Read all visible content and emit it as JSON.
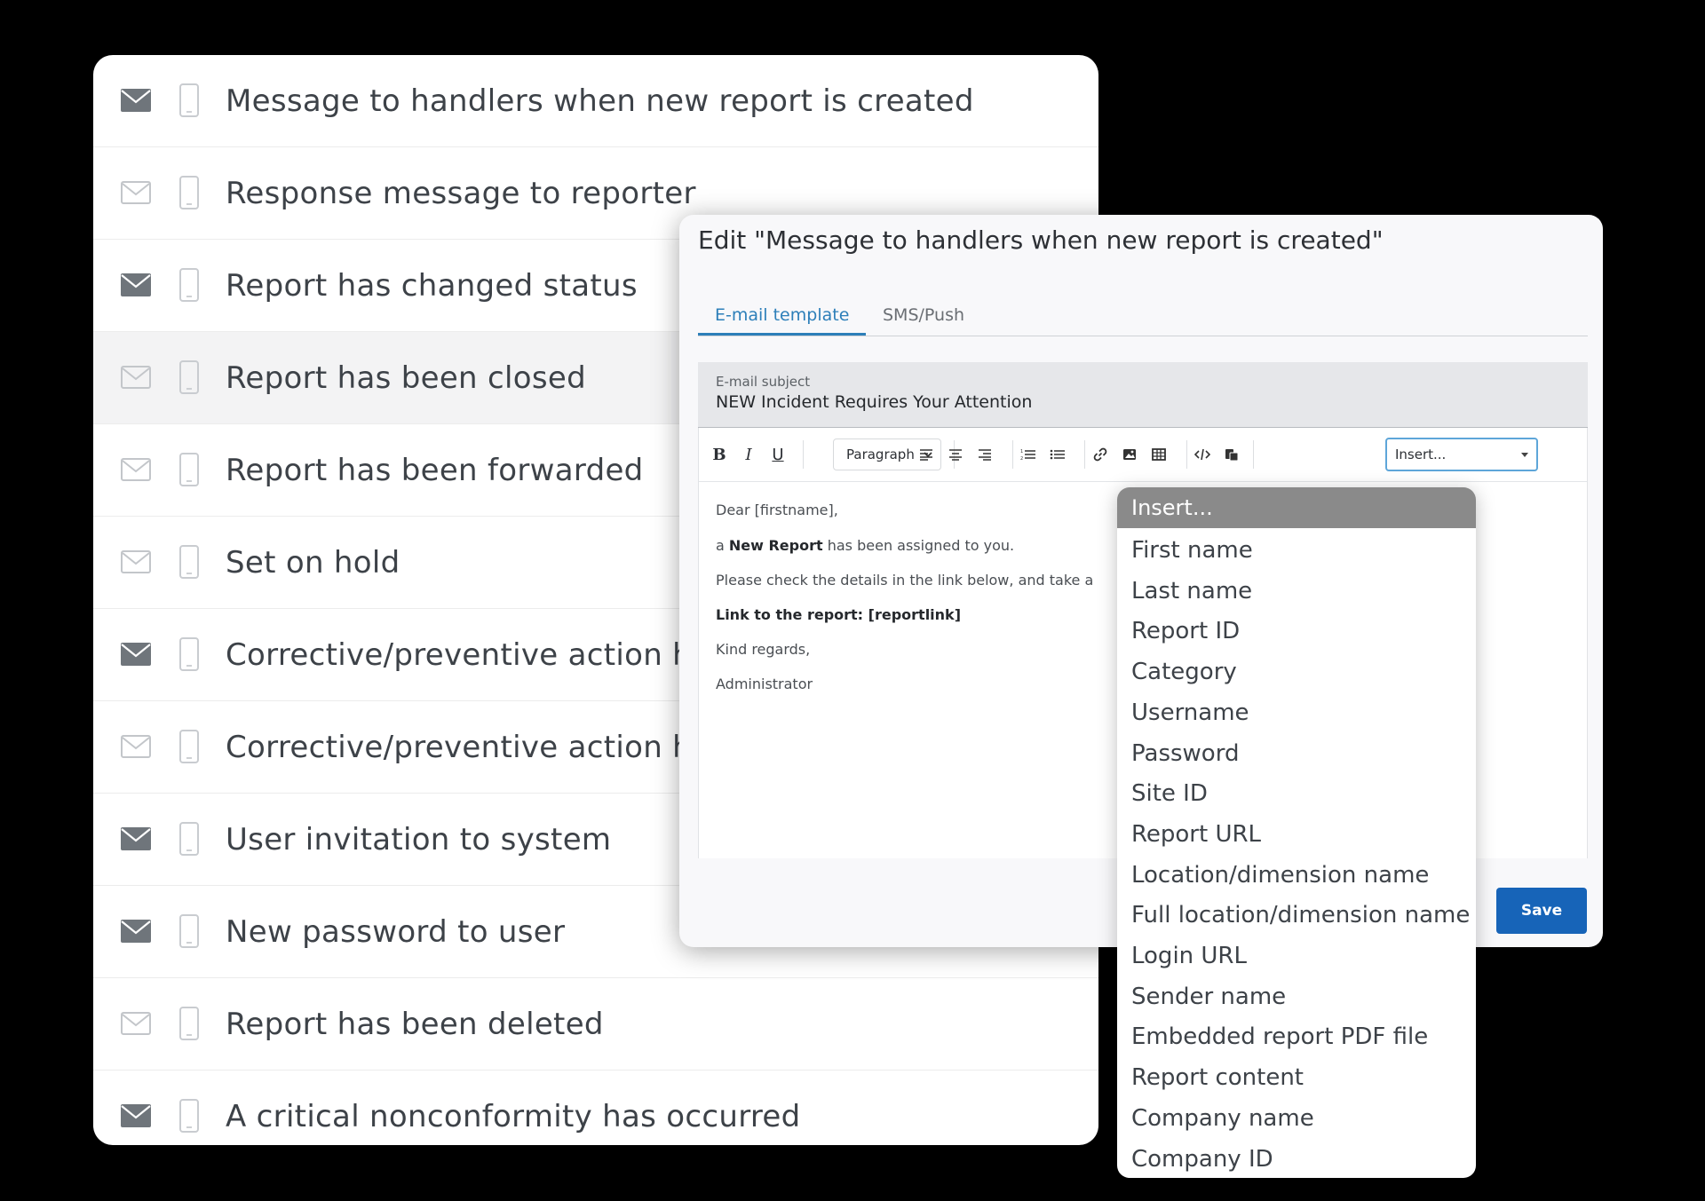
{
  "notification_list": {
    "rows": [
      {
        "label": "Message to handlers when new report is created",
        "email_active": true
      },
      {
        "label": "Response message to reporter",
        "email_active": false
      },
      {
        "label": "Report has changed status",
        "email_active": true
      },
      {
        "label": "Report has been closed",
        "email_active": false
      },
      {
        "label": "Report has been forwarded",
        "email_active": false
      },
      {
        "label": "Set on hold",
        "email_active": false
      },
      {
        "label": "Corrective/preventive action ha",
        "email_active": true
      },
      {
        "label": "Corrective/preventive action ha",
        "email_active": false
      },
      {
        "label": "User invitation to system",
        "email_active": true
      },
      {
        "label": "New password to user",
        "email_active": true
      },
      {
        "label": "Report has been deleted",
        "email_active": false
      },
      {
        "label": "A critical nonconformity has occurred",
        "email_active": true
      }
    ]
  },
  "dialog": {
    "title": "Edit \"Message to handlers when new report is created\"",
    "tabs": {
      "email": "E-mail template",
      "sms": "SMS/Push"
    },
    "subject": {
      "label": "E-mail subject",
      "value": "NEW Incident Requires Your Attention"
    },
    "toolbar": {
      "bold": "B",
      "italic": "I",
      "underline": "U",
      "paragraph": "Paragraph",
      "insert": "Insert..."
    },
    "body": {
      "greeting": "Dear [firstname],",
      "line1_prefix": "a ",
      "line1_bold": "New Report",
      "line1_suffix": " has been assigned to you.",
      "line2": "Please check the details in the link below, and take a",
      "line3": "Link to the report: [reportlink]",
      "line4": "Kind regards,",
      "line5": "Administrator"
    },
    "save_label": "Save"
  },
  "insert_dropdown": {
    "header": "Insert...",
    "items": [
      "First name",
      "Last name",
      "Report ID",
      "Category",
      "Username",
      "Password",
      "Site ID",
      "Report URL",
      "Location/dimension name",
      "Full location/dimension name",
      "Login URL",
      "Sender name",
      "Embedded report PDF file",
      "Report content",
      "Company name",
      "Company ID"
    ]
  },
  "colors": {
    "accent": "#2d7fb9",
    "save_button": "#1764b8",
    "dropdown_header": "#8a8a8a",
    "email_active": "#6f757b",
    "email_inactive": "#c3c6ca"
  }
}
